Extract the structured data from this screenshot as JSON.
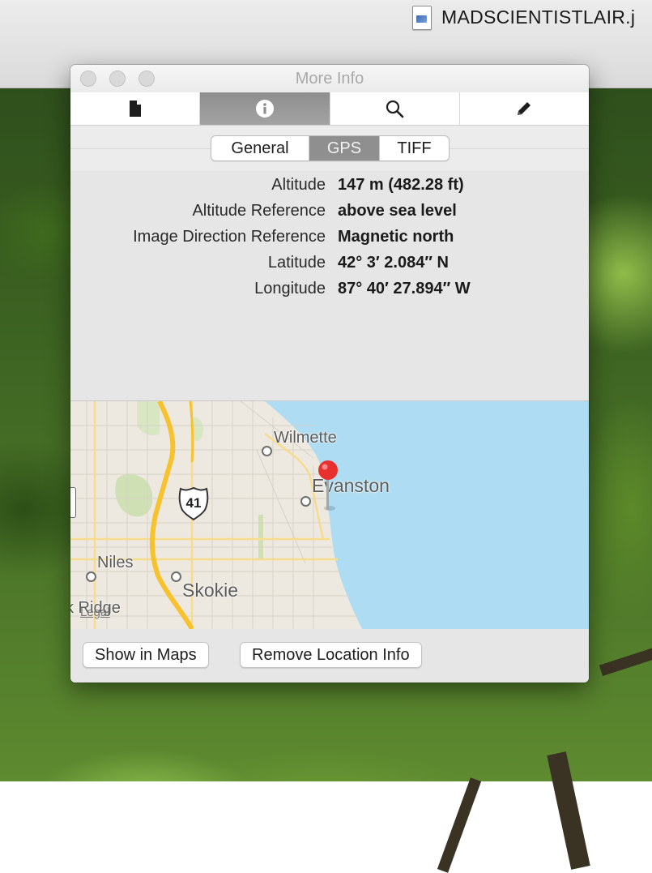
{
  "viewer": {
    "file_name": "MADSCIENTISTLAIR.j",
    "file_icon": "jpeg-file-icon"
  },
  "window": {
    "title": "More Info",
    "traffic_lights": [
      "close-button",
      "minimize-button",
      "zoom-button"
    ]
  },
  "toolbar": {
    "tabs": [
      {
        "icon": "document-icon",
        "selected": false
      },
      {
        "icon": "info-icon",
        "selected": true
      },
      {
        "icon": "magnifier-icon",
        "selected": false
      },
      {
        "icon": "pencil-icon",
        "selected": false
      }
    ]
  },
  "segments": {
    "items": [
      "General",
      "GPS",
      "TIFF"
    ],
    "selected": "GPS"
  },
  "gps": {
    "rows": [
      {
        "key": "Altitude",
        "value": "147 m (482.28 ft)"
      },
      {
        "key": "Altitude Reference",
        "value": "above sea level"
      },
      {
        "key": "Image Direction Reference",
        "value": "Magnetic north"
      },
      {
        "key": "Latitude",
        "value": "42° 3′ 2.084″ N"
      },
      {
        "key": "Longitude",
        "value": "87° 40′ 27.894″ W"
      }
    ]
  },
  "map": {
    "labels": {
      "wilmette": "Wilmette",
      "evanston": "Evanston",
      "niles": "Niles",
      "skokie": "Skokie",
      "park_ridge": "k Ridge",
      "legal": "Legal"
    },
    "route_shield": "41",
    "colors": {
      "water": "#aedcf2",
      "land": "#ede9e0",
      "highway": "#f8c22f",
      "park": "#cfe0b4",
      "pin": "#e8312f"
    }
  },
  "buttons": {
    "show_in_maps": "Show in Maps",
    "remove_location": "Remove Location Info"
  }
}
